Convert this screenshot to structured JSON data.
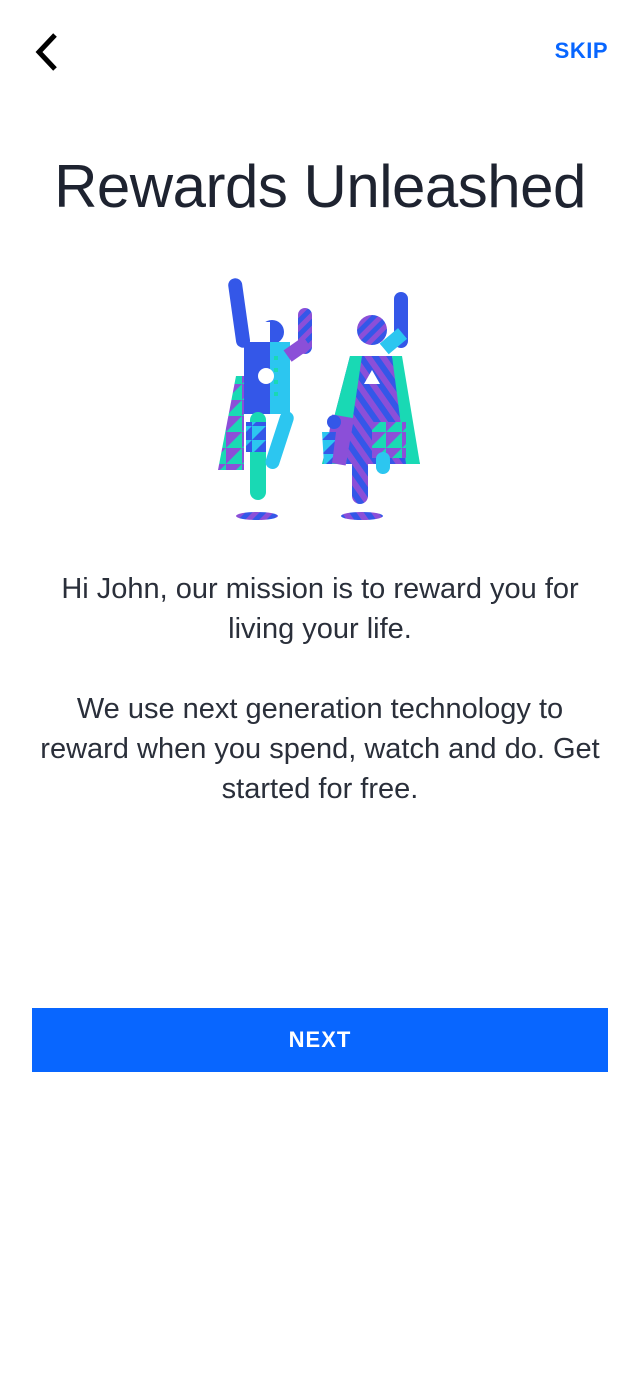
{
  "header": {
    "back_icon": "chevron-left-icon",
    "skip_label": "SKIP"
  },
  "main": {
    "title": "Rewards Unleashed",
    "illustration_icon": "two-jumping-people-illustration",
    "paragraph_1": "Hi John, our mission is to reward you for living your life.",
    "paragraph_2": "We use next generation technology to reward when you spend, watch and do. Get started for free."
  },
  "footer": {
    "next_label": "NEXT"
  },
  "colors": {
    "accent": "#0866ff",
    "title_text": "#1e2330",
    "body_text": "#2a2f3a",
    "illustration_blue": "#3457e8",
    "illustration_teal": "#19d9b4",
    "illustration_purple": "#8b4fd8",
    "illustration_cyan": "#2cc6f0"
  }
}
